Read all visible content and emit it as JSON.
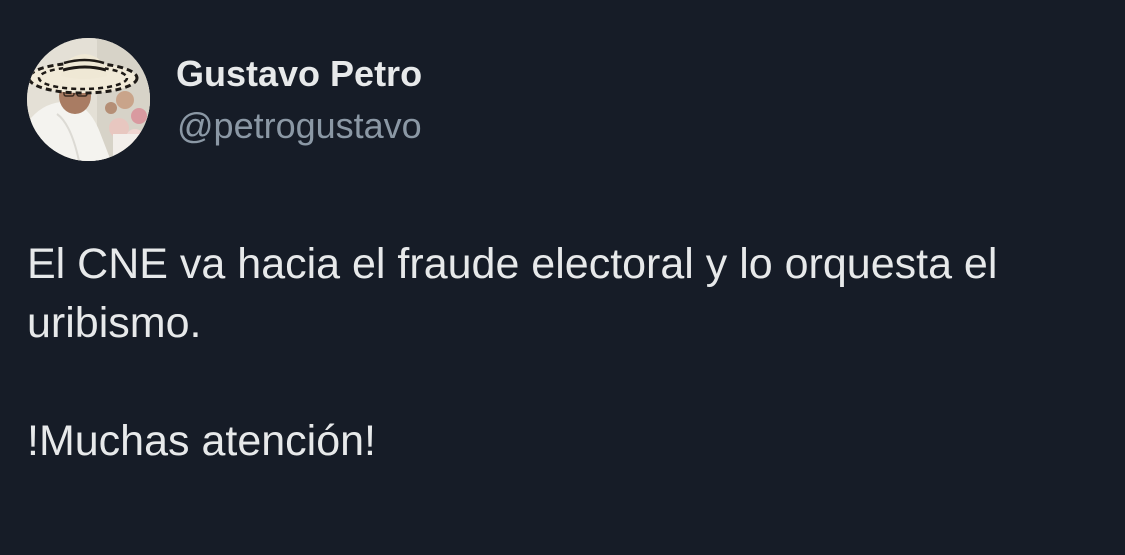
{
  "author": {
    "display_name": "Gustavo Petro",
    "handle": "@petrogustavo",
    "avatar_icon": "profile-photo-sombrero-vueltiao"
  },
  "tweet": {
    "paragraphs": [
      "El CNE va hacia el fraude electoral y lo orquesta el uribismo.",
      "!Muchas atención!"
    ]
  },
  "colors": {
    "background": "#161c27",
    "primary_text": "#e7e9ea",
    "secondary_text": "#8b98a5"
  }
}
